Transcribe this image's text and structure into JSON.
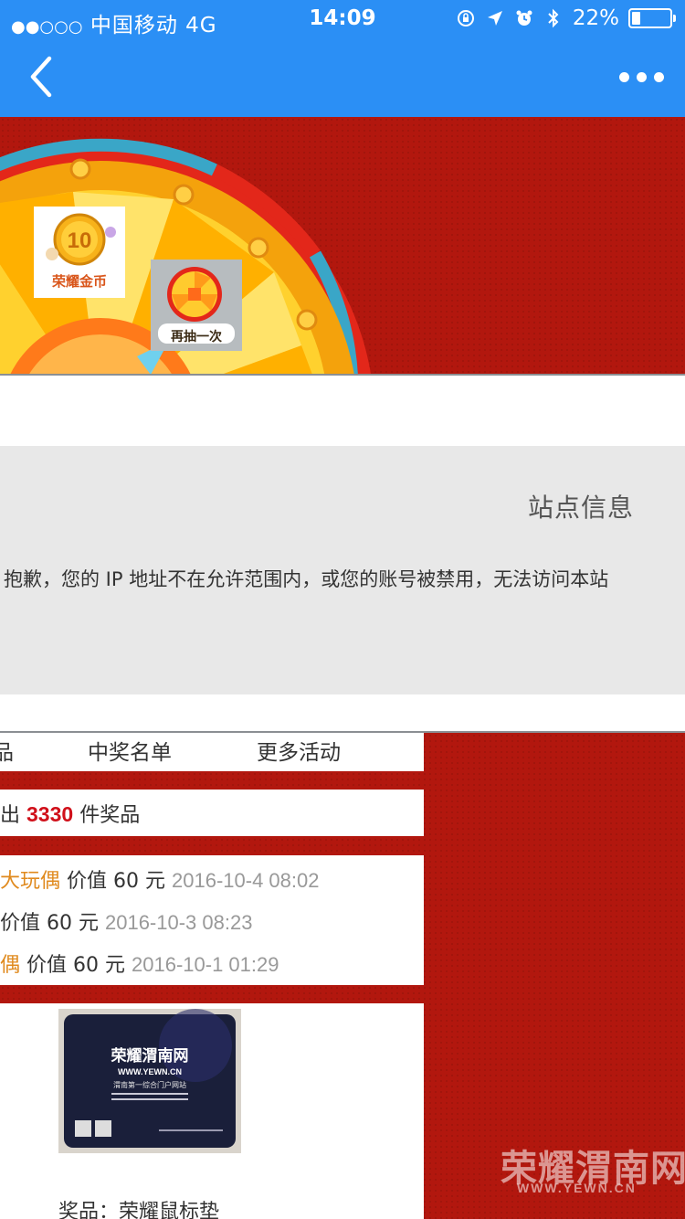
{
  "status_bar": {
    "signal_dots": "●●○○○",
    "carrier": "中国移动",
    "network": "4G",
    "time": "14:09",
    "battery": "22%",
    "battery_level": 0.22,
    "icons": [
      "orientation-lock-icon",
      "location-arrow-icon",
      "alarm-icon",
      "bluetooth-icon",
      "battery-icon"
    ]
  },
  "nav": {
    "back_icon": "chevron-left-icon",
    "more_icon": "more-dots-icon",
    "bar_color": "#2b8ff5"
  },
  "banner": {
    "coin_badge": "荣耀金币",
    "coin_number": "10",
    "spin_again": "再抽一次",
    "bg_color": "#b2170e"
  },
  "site_info": {
    "title": "站点信息",
    "message": "抱歉，您的 IP 地址不在允许范围内，或您的账号被禁用，无法访问本站"
  },
  "tabs": {
    "first_partial": "品",
    "winners_list": "中奖名单",
    "more_activities": "更多活动"
  },
  "total": {
    "prefix": "出",
    "count": "3330",
    "suffix": "件奖品"
  },
  "winners": [
    {
      "prize": "大玩偶",
      "value": "价值 60 元",
      "date": "2016-10-4 08:02"
    },
    {
      "prize": "",
      "value": "价值 60 元",
      "date": "2016-10-3 08:23"
    },
    {
      "prize": "偶",
      "value": "价值 60 元",
      "date": "2016-10-1 01:29"
    }
  ],
  "prize_item": {
    "label": "奖品：荣耀鼠标垫",
    "pad_brand": "荣耀渭南网",
    "pad_url": "WWW.YEWN.CN",
    "pad_slogan": "渭南第一综合门户网站"
  },
  "watermark": {
    "main": "荣耀渭南网",
    "sub": "WWW.YEWN.CN"
  }
}
